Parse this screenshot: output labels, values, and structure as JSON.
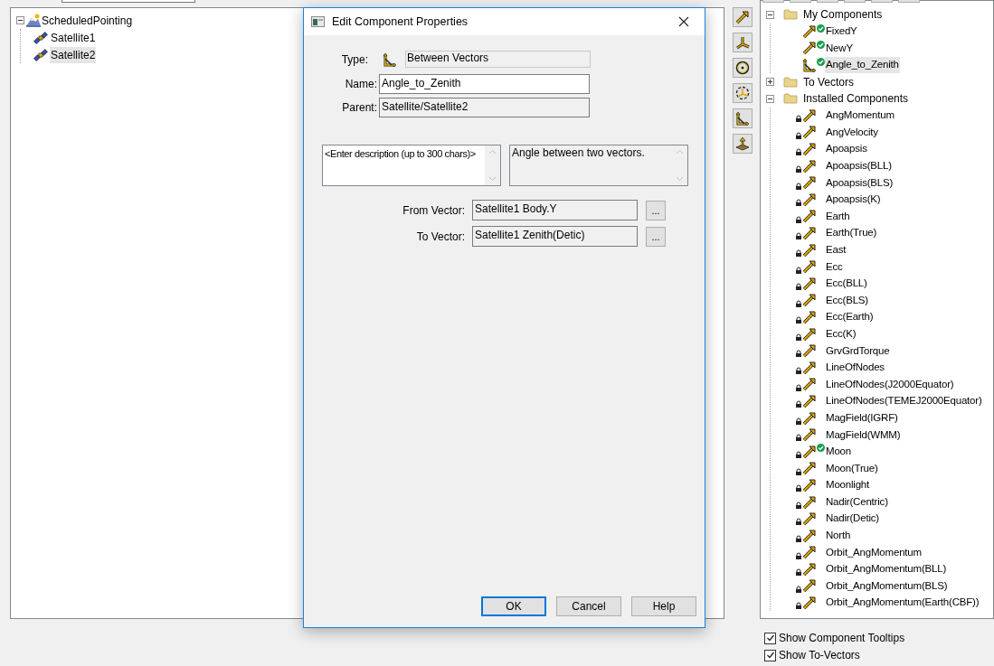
{
  "scenario_tree": [
    {
      "label": "ScheduledPointing",
      "kind": "scenario",
      "expanded": true,
      "selected": false,
      "children": [
        {
          "label": "Satellite1",
          "kind": "satellite",
          "selected": false
        },
        {
          "label": "Satellite2",
          "kind": "satellite",
          "selected": true
        }
      ]
    }
  ],
  "dialog": {
    "title": "Edit Component Properties",
    "type": {
      "label": "Type:",
      "value": "Between Vectors"
    },
    "name": {
      "label": "Name:",
      "value": "Angle_to_Zenith"
    },
    "parent": {
      "label": "Parent:",
      "value": "Satellite/Satellite2"
    },
    "description": {
      "placeholder": "<Enter description (up to 300 chars)>"
    },
    "type_description": "Angle between two vectors.",
    "vectors": [
      {
        "label": "From Vector:",
        "value": "Satellite1 Body.Y",
        "browse": "..."
      },
      {
        "label": "To Vector:",
        "value": "Satellite1 Zenith(Detic)",
        "browse": "..."
      }
    ],
    "buttons": [
      {
        "label": "OK",
        "default": true
      },
      {
        "label": "Cancel",
        "default": false
      },
      {
        "label": "Help",
        "default": false
      }
    ]
  },
  "component_tree": [
    {
      "label": "My Components",
      "expanded": true,
      "children": [
        {
          "label": "FixedY",
          "kind": "vector",
          "locked": false,
          "in_use": true,
          "selected": false
        },
        {
          "label": "NewY",
          "kind": "vector",
          "locked": false,
          "in_use": true,
          "selected": false
        },
        {
          "label": "Angle_to_Zenith",
          "kind": "angle",
          "locked": false,
          "in_use": true,
          "selected": true
        }
      ]
    },
    {
      "label": "To Vectors",
      "expanded": false
    },
    {
      "label": "Installed Components",
      "expanded": true,
      "children": [
        {
          "label": "AngMomentum",
          "kind": "vector",
          "locked": true,
          "in_use": false,
          "selected": false
        },
        {
          "label": "AngVelocity",
          "kind": "vector",
          "locked": true,
          "in_use": false,
          "selected": false
        },
        {
          "label": "Apoapsis",
          "kind": "vector",
          "locked": true,
          "in_use": false,
          "selected": false
        },
        {
          "label": "Apoapsis(BLL)",
          "kind": "vector",
          "locked": true,
          "in_use": false,
          "selected": false
        },
        {
          "label": "Apoapsis(BLS)",
          "kind": "vector",
          "locked": true,
          "in_use": false,
          "selected": false
        },
        {
          "label": "Apoapsis(K)",
          "kind": "vector",
          "locked": true,
          "in_use": false,
          "selected": false
        },
        {
          "label": "Earth",
          "kind": "vector",
          "locked": true,
          "in_use": false,
          "selected": false
        },
        {
          "label": "Earth(True)",
          "kind": "vector",
          "locked": true,
          "in_use": false,
          "selected": false
        },
        {
          "label": "East",
          "kind": "vector",
          "locked": true,
          "in_use": false,
          "selected": false
        },
        {
          "label": "Ecc",
          "kind": "vector",
          "locked": true,
          "in_use": false,
          "selected": false
        },
        {
          "label": "Ecc(BLL)",
          "kind": "vector",
          "locked": true,
          "in_use": false,
          "selected": false
        },
        {
          "label": "Ecc(BLS)",
          "kind": "vector",
          "locked": true,
          "in_use": false,
          "selected": false
        },
        {
          "label": "Ecc(Earth)",
          "kind": "vector",
          "locked": true,
          "in_use": false,
          "selected": false
        },
        {
          "label": "Ecc(K)",
          "kind": "vector",
          "locked": true,
          "in_use": false,
          "selected": false
        },
        {
          "label": "GrvGrdTorque",
          "kind": "vector",
          "locked": true,
          "in_use": false,
          "selected": false
        },
        {
          "label": "LineOfNodes",
          "kind": "vector",
          "locked": true,
          "in_use": false,
          "selected": false
        },
        {
          "label": "LineOfNodes(J2000Equator)",
          "kind": "vector",
          "locked": true,
          "in_use": false,
          "selected": false
        },
        {
          "label": "LineOfNodes(TEMEJ2000Equator)",
          "kind": "vector",
          "locked": true,
          "in_use": false,
          "selected": false
        },
        {
          "label": "MagField(IGRF)",
          "kind": "vector",
          "locked": true,
          "in_use": false,
          "selected": false
        },
        {
          "label": "MagField(WMM)",
          "kind": "vector",
          "locked": true,
          "in_use": false,
          "selected": false
        },
        {
          "label": "Moon",
          "kind": "vector",
          "locked": true,
          "in_use": true,
          "selected": false
        },
        {
          "label": "Moon(True)",
          "kind": "vector",
          "locked": true,
          "in_use": false,
          "selected": false
        },
        {
          "label": "Moonlight",
          "kind": "vector",
          "locked": true,
          "in_use": false,
          "selected": false
        },
        {
          "label": "Nadir(Centric)",
          "kind": "vector",
          "locked": true,
          "in_use": false,
          "selected": false
        },
        {
          "label": "Nadir(Detic)",
          "kind": "vector",
          "locked": true,
          "in_use": false,
          "selected": false
        },
        {
          "label": "North",
          "kind": "vector",
          "locked": true,
          "in_use": false,
          "selected": false
        },
        {
          "label": "Orbit_AngMomentum",
          "kind": "vector",
          "locked": true,
          "in_use": false,
          "selected": false
        },
        {
          "label": "Orbit_AngMomentum(BLL)",
          "kind": "vector",
          "locked": true,
          "in_use": false,
          "selected": false
        },
        {
          "label": "Orbit_AngMomentum(BLS)",
          "kind": "vector",
          "locked": true,
          "in_use": false,
          "selected": false
        },
        {
          "label": "Orbit_AngMomentum(Earth(CBF))",
          "kind": "vector",
          "locked": true,
          "in_use": false,
          "selected": false
        }
      ]
    }
  ],
  "options": [
    {
      "label": "Show Component Tooltips",
      "checked": true
    },
    {
      "label": "Show To-Vectors",
      "checked": true
    }
  ]
}
